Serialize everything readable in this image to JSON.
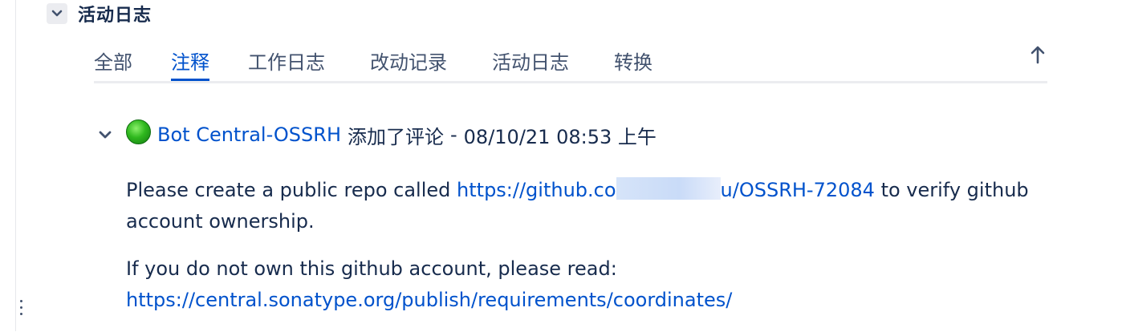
{
  "section": {
    "title": "活动日志"
  },
  "tabs": [
    {
      "label": "全部",
      "active": false
    },
    {
      "label": "注释",
      "active": true
    },
    {
      "label": "工作日志",
      "active": false
    },
    {
      "label": "改动记录",
      "active": false
    },
    {
      "label": "活动日志",
      "active": false
    },
    {
      "label": "转换",
      "active": false
    }
  ],
  "scroll_top": {
    "icon": "arrow-up-icon"
  },
  "comment": {
    "author": "Bot Central-OSSRH",
    "action": "添加了评论",
    "separator": "-",
    "timestamp": "08/10/21 08:53 上午",
    "paragraph1": {
      "before": "Please create a public repo called",
      "link_start": "https://github.co",
      "link_end": "u/OSSRH-72084",
      "after": "to verify github account ownership."
    },
    "paragraph2": {
      "text": "If you do not own this github account, please read:",
      "link": "https://central.sonatype.org/publish/requirements/coordinates/"
    }
  },
  "colors": {
    "link": "#0052cc",
    "text": "#172b4d",
    "tab_underline": "#0052cc",
    "divider": "#ebecf0"
  }
}
